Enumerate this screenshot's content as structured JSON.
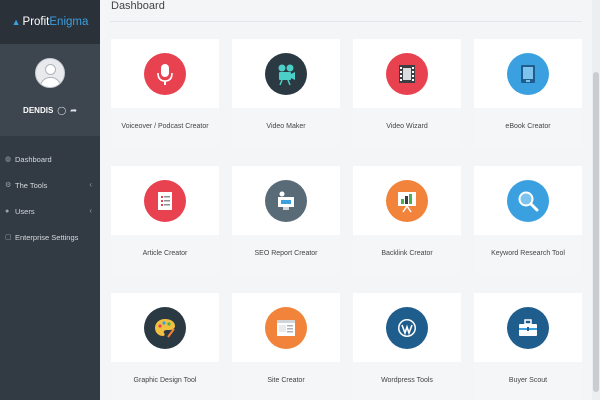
{
  "brand": {
    "part1": "Profit",
    "part2": "Enigma"
  },
  "user": {
    "name": "DENDIS"
  },
  "nav": [
    {
      "label": "Dashboard",
      "icon": "gauge-icon"
    },
    {
      "label": "The Tools",
      "icon": "tools-icon",
      "has_submenu": true
    },
    {
      "label": "Users",
      "icon": "users-icon",
      "has_submenu": true
    },
    {
      "label": "Enterprise Settings",
      "icon": "settings-icon"
    }
  ],
  "page": {
    "title": "Dashboard"
  },
  "cards": [
    {
      "label": "Voiceover / Podcast Creator",
      "icon": "microphone-icon",
      "color": "#e8414f"
    },
    {
      "label": "Video Maker",
      "icon": "video-camera-icon",
      "color": "#2b3942"
    },
    {
      "label": "Video Wizard",
      "icon": "film-strip-icon",
      "color": "#e8414f"
    },
    {
      "label": "eBook Creator",
      "icon": "ebook-icon",
      "color": "#3aa0e0"
    },
    {
      "label": "Article Creator",
      "icon": "checklist-icon",
      "color": "#e8414f"
    },
    {
      "label": "SEO Report Creator",
      "icon": "seo-report-icon",
      "color": "#5a6b78"
    },
    {
      "label": "Backlink Creator",
      "icon": "chart-board-icon",
      "color": "#f1833a"
    },
    {
      "label": "Keyword Research Tool",
      "icon": "magnifier-icon",
      "color": "#3aa0e0"
    },
    {
      "label": "Graphic Design Tool",
      "icon": "palette-icon",
      "color": "#2b3942"
    },
    {
      "label": "Site Creator",
      "icon": "browser-window-icon",
      "color": "#f1833a"
    },
    {
      "label": "Wordpress Tools",
      "icon": "wordpress-icon",
      "color": "#1f5d8c"
    },
    {
      "label": "Buyer Scout",
      "icon": "briefcase-icon",
      "color": "#1f5d8c"
    }
  ]
}
